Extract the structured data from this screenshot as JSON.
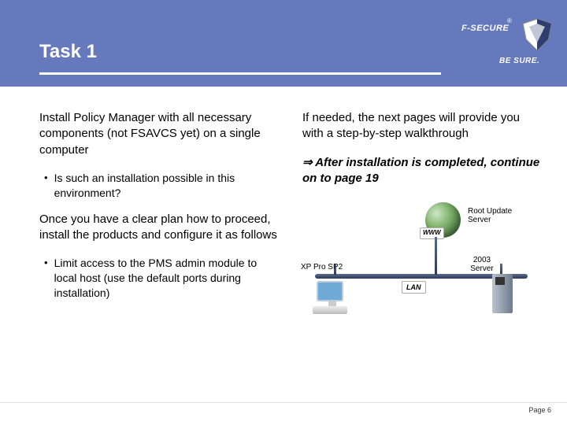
{
  "brand": {
    "name": "F-SECURE",
    "tagline": "BE SURE.",
    "reg": "®"
  },
  "title": "Task 1",
  "left": {
    "p1": "Install Policy Manager with all necessary components (not FSAVCS yet) on a single computer",
    "b1": "Is such an installation possible in this environment?",
    "p2": "Once you have a clear plan how to proceed, install the products and configure it as follows",
    "b2": "Limit access to the PMS admin module to local host (use the default ports during installation)"
  },
  "right": {
    "p1": "If needed, the next pages will provide you with a step-by-step walkthrough",
    "arrow": "⇒",
    "p2": "After installation is completed, continue on to page 19"
  },
  "diagram": {
    "root_label": "Root Update\nServer",
    "www": "WWW",
    "lan": "LAN",
    "pc_label": "XP Pro SP2",
    "server_label": "2003\nServer"
  },
  "footer": {
    "page_label": "Page",
    "page_num": "6"
  }
}
